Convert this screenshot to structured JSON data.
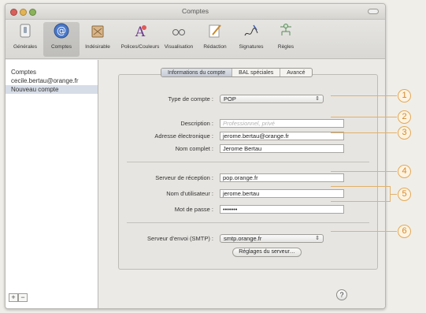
{
  "window": {
    "title": "Comptes"
  },
  "toolbar": {
    "items": [
      {
        "label": "Générales",
        "icon": "switch-icon"
      },
      {
        "label": "Comptes",
        "icon": "at-icon"
      },
      {
        "label": "Indésirable",
        "icon": "trash-icon"
      },
      {
        "label": "Polices/Couleurs",
        "icon": "font-icon"
      },
      {
        "label": "Visualisation",
        "icon": "glasses-icon"
      },
      {
        "label": "Rédaction",
        "icon": "pencil-icon"
      },
      {
        "label": "Signatures",
        "icon": "signature-icon"
      },
      {
        "label": "Règles",
        "icon": "rules-icon"
      }
    ],
    "selected": "Comptes"
  },
  "sidebar": {
    "items": [
      "Comptes",
      "cecile.bertau@orange.fr",
      "Nouveau compte"
    ],
    "selected": "Nouveau compte",
    "add_label": "+",
    "remove_label": "−"
  },
  "tabs": {
    "items": [
      "Informations du compte",
      "BAL spéciales",
      "Avancé"
    ],
    "selected": "Informations du compte"
  },
  "form": {
    "account_type_label": "Type de compte :",
    "account_type_value": "POP",
    "description_label": "Description :",
    "description_placeholder": "Professionnel, privé",
    "email_label": "Adresse électronique :",
    "email_value": "jerome.bertau@orange.fr",
    "fullname_label": "Nom complet :",
    "fullname_value": "Jerome Bertau",
    "incoming_label": "Serveur de réception :",
    "incoming_value": "pop.orange.fr",
    "username_label": "Nom d'utilisateur :",
    "username_value": "jerome.bertau",
    "password_label": "Mot de passe :",
    "password_value": "•••••••",
    "smtp_label": "Serveur d'envoi (SMTP) :",
    "smtp_value": "smtp.orange.fr",
    "server_settings_label": "Réglages du serveur…"
  },
  "help_label": "?",
  "callouts": [
    "1",
    "2",
    "3",
    "4",
    "5",
    "6"
  ],
  "colors": {
    "callout": "#d18a2e",
    "selection": "#d7dde7"
  }
}
